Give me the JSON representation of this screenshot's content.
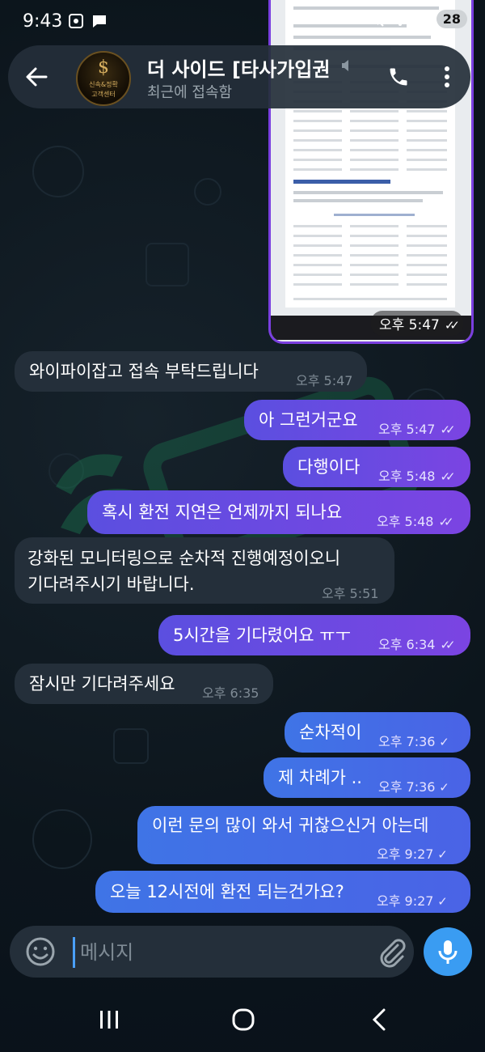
{
  "status_bar": {
    "time": "9:43",
    "notification_count": "28"
  },
  "header": {
    "title": "더 사이드 [타사가입권",
    "status": "최근에 접속함",
    "avatar_line1": "신속&정확",
    "avatar_line2": "고객센터"
  },
  "image_message": {
    "time": "오후 5:47"
  },
  "messages": [
    {
      "text": "와이파이잡고 접속 부탁드립니다",
      "time": "오후 5:47"
    },
    {
      "text": "아 그런거군요",
      "time": "오후 5:47"
    },
    {
      "text": "다행이다",
      "time": "오후 5:48"
    },
    {
      "text": "혹시 환전 지연은 언제까지 되나요",
      "time": "오후 5:48"
    },
    {
      "text_line1": "강화된 모니터링으로 순차적 진행예정이오니",
      "text_line2": "기다려주시기 바랍니다.",
      "time": "오후 5:51"
    },
    {
      "text": "5시간을 기다렸어요 ㅠㅜ",
      "time": "오후 6:34"
    },
    {
      "text": "잠시만 기다려주세요",
      "time": "오후 6:35"
    },
    {
      "text": "순차적이",
      "time": "오후 7:36"
    },
    {
      "text": "제 차례가 ..",
      "time": "오후 7:36"
    },
    {
      "text": "이런 문의 많이 와서 귀찮으신거 아는데",
      "time": "오후 9:27"
    },
    {
      "text": "오늘 12시전에 환전 되는건가요?",
      "time": "오후 9:27"
    }
  ],
  "input": {
    "placeholder": "메시지"
  },
  "icons": {
    "back": "arrow-left-icon",
    "call": "phone-icon",
    "menu": "more-vertical-icon",
    "emoji": "smile-icon",
    "attach": "paperclip-icon",
    "mic": "microphone-icon"
  },
  "colors": {
    "outgoing": "#6a4be2",
    "outgoing_blue": "#4470e6",
    "incoming": "#242f3a",
    "mic": "#3a9cf2"
  }
}
